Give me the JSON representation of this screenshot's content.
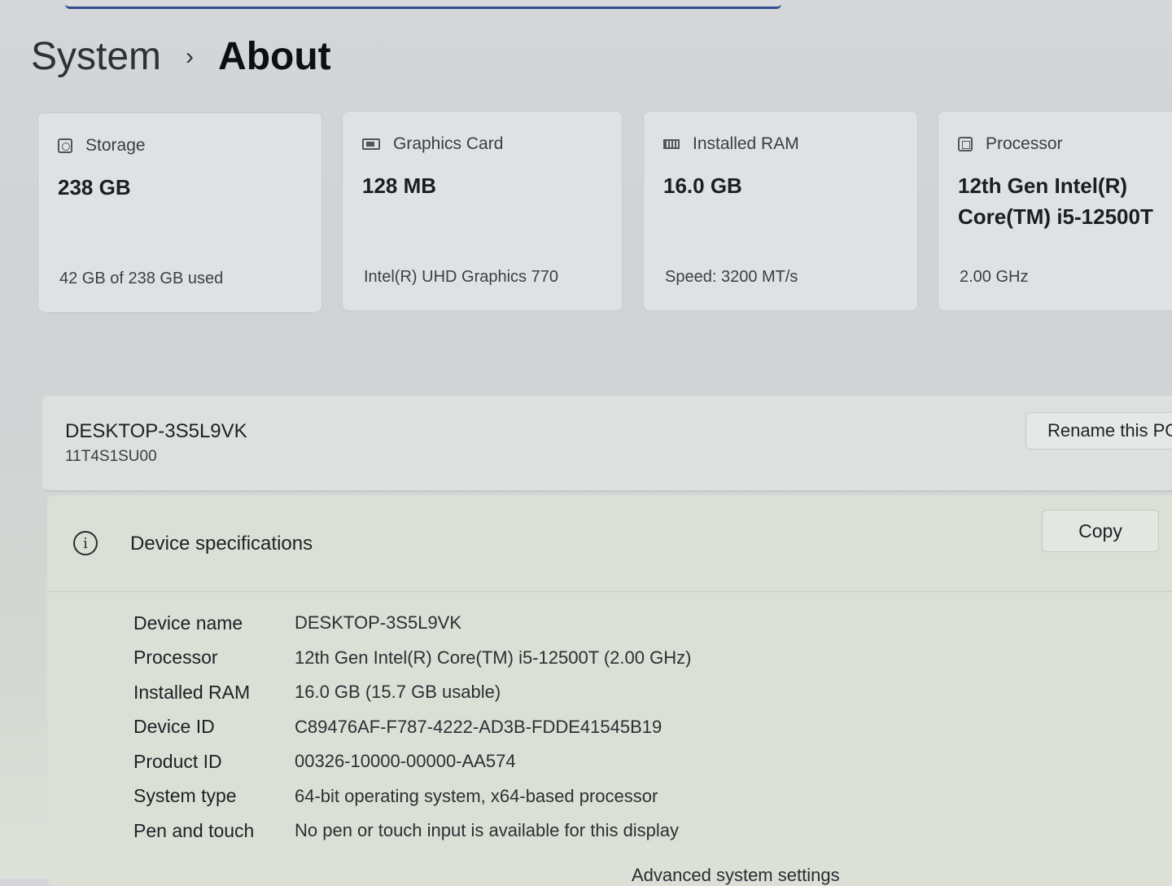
{
  "breadcrumb": {
    "parent": "System",
    "separator": "›",
    "current": "About"
  },
  "cards": [
    {
      "name": "Storage",
      "value": "238 GB",
      "value2": "",
      "sub": "42 GB of 238 GB used"
    },
    {
      "name": "Graphics Card",
      "value": "128 MB",
      "value2": "",
      "sub": "Intel(R) UHD Graphics 770"
    },
    {
      "name": "Installed RAM",
      "value": "16.0 GB",
      "value2": "",
      "sub": "Speed: 3200 MT/s"
    },
    {
      "name": "Processor",
      "value": "12th Gen Intel(R)",
      "value2": "Core(TM) i5-12500T",
      "sub": "2.00 GHz"
    }
  ],
  "pc": {
    "name": "DESKTOP-3S5L9VK",
    "model": "11T4S1SU00",
    "rename_label": "Rename this PC"
  },
  "specs": {
    "title": "Device specifications",
    "copy_label": "Copy",
    "rows": [
      {
        "label": "Device name",
        "value": "DESKTOP-3S5L9VK"
      },
      {
        "label": "Processor",
        "value": "12th Gen Intel(R) Core(TM) i5-12500T (2.00 GHz)"
      },
      {
        "label": "Installed RAM",
        "value": "16.0 GB (15.7 GB usable)"
      },
      {
        "label": "Device ID",
        "value": "C89476AF-F787-4222-AD3B-FDDE41545B19"
      },
      {
        "label": "Product ID",
        "value": "00326-10000-00000-AA574"
      },
      {
        "label": "System type",
        "value": "64-bit operating system, x64-based processor"
      },
      {
        "label": "Pen and touch",
        "value": "No pen or touch input is available for this display"
      }
    ]
  },
  "advanced_link": "Advanced system settings",
  "icons": {
    "storage": "storage-icon",
    "gpu": "graphics-card-icon",
    "ram": "ram-icon",
    "cpu": "processor-icon",
    "info": "info-icon"
  }
}
